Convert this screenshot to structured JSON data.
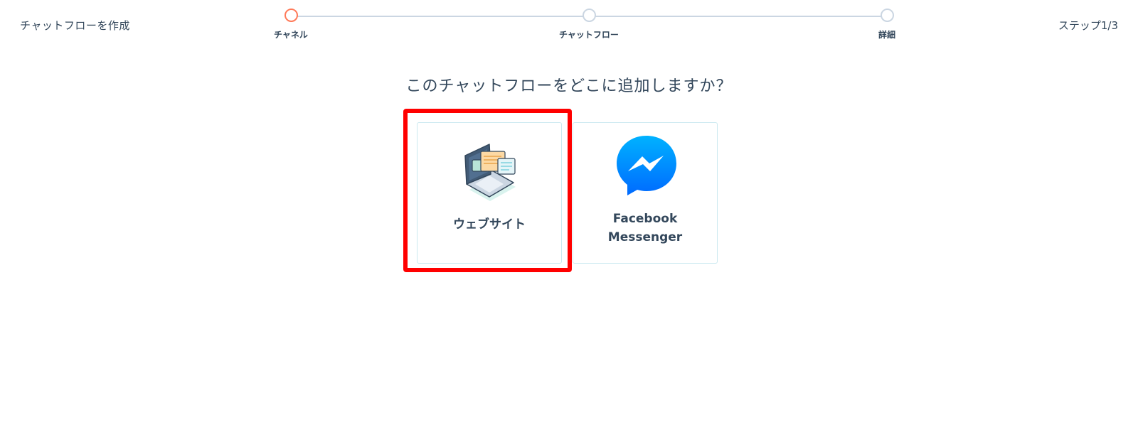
{
  "header": {
    "title": "チャットフローを作成",
    "step_counter": "ステップ1/3"
  },
  "stepper": {
    "steps": [
      {
        "label": "チャネル",
        "state": "active"
      },
      {
        "label": "チャットフロー",
        "state": "inactive"
      },
      {
        "label": "詳細",
        "state": "inactive"
      }
    ]
  },
  "question": "このチャットフローをどこに追加しますか？",
  "channels": [
    {
      "label": "ウェブサイト",
      "icon": "website-chat-icon",
      "selected": true
    },
    {
      "label_line1": "Facebook",
      "label_line2": "Messenger",
      "icon": "facebook-messenger-icon",
      "selected": false
    }
  ],
  "colors": {
    "active_step": "#ff7a59",
    "inactive_step": "#cbd6e2",
    "text": "#33475b",
    "card_border": "#cbe9f0",
    "highlight": "#ff0000",
    "messenger_blue": "#0084ff"
  }
}
